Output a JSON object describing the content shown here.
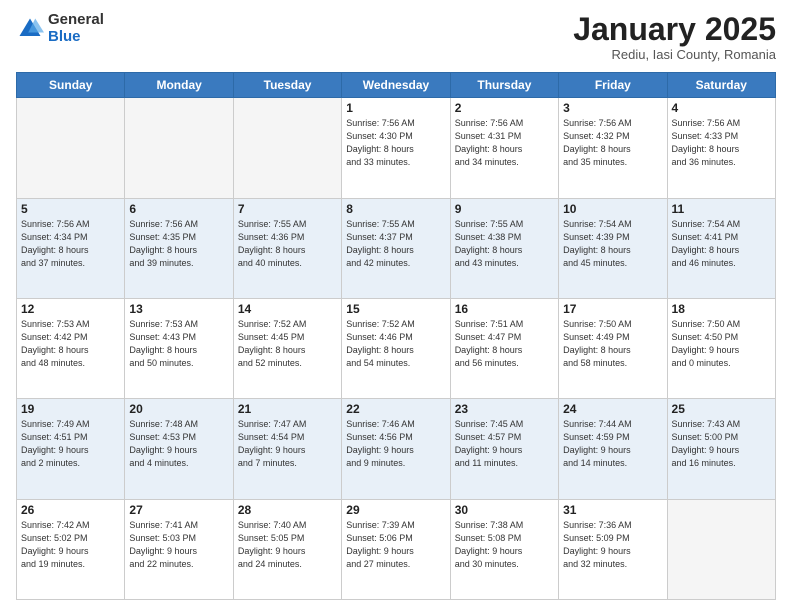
{
  "logo": {
    "general": "General",
    "blue": "Blue"
  },
  "title": "January 2025",
  "subtitle": "Rediu, Iasi County, Romania",
  "weekdays": [
    "Sunday",
    "Monday",
    "Tuesday",
    "Wednesday",
    "Thursday",
    "Friday",
    "Saturday"
  ],
  "weeks": [
    [
      {
        "day": "",
        "info": ""
      },
      {
        "day": "",
        "info": ""
      },
      {
        "day": "",
        "info": ""
      },
      {
        "day": "1",
        "info": "Sunrise: 7:56 AM\nSunset: 4:30 PM\nDaylight: 8 hours\nand 33 minutes."
      },
      {
        "day": "2",
        "info": "Sunrise: 7:56 AM\nSunset: 4:31 PM\nDaylight: 8 hours\nand 34 minutes."
      },
      {
        "day": "3",
        "info": "Sunrise: 7:56 AM\nSunset: 4:32 PM\nDaylight: 8 hours\nand 35 minutes."
      },
      {
        "day": "4",
        "info": "Sunrise: 7:56 AM\nSunset: 4:33 PM\nDaylight: 8 hours\nand 36 minutes."
      }
    ],
    [
      {
        "day": "5",
        "info": "Sunrise: 7:56 AM\nSunset: 4:34 PM\nDaylight: 8 hours\nand 37 minutes."
      },
      {
        "day": "6",
        "info": "Sunrise: 7:56 AM\nSunset: 4:35 PM\nDaylight: 8 hours\nand 39 minutes."
      },
      {
        "day": "7",
        "info": "Sunrise: 7:55 AM\nSunset: 4:36 PM\nDaylight: 8 hours\nand 40 minutes."
      },
      {
        "day": "8",
        "info": "Sunrise: 7:55 AM\nSunset: 4:37 PM\nDaylight: 8 hours\nand 42 minutes."
      },
      {
        "day": "9",
        "info": "Sunrise: 7:55 AM\nSunset: 4:38 PM\nDaylight: 8 hours\nand 43 minutes."
      },
      {
        "day": "10",
        "info": "Sunrise: 7:54 AM\nSunset: 4:39 PM\nDaylight: 8 hours\nand 45 minutes."
      },
      {
        "day": "11",
        "info": "Sunrise: 7:54 AM\nSunset: 4:41 PM\nDaylight: 8 hours\nand 46 minutes."
      }
    ],
    [
      {
        "day": "12",
        "info": "Sunrise: 7:53 AM\nSunset: 4:42 PM\nDaylight: 8 hours\nand 48 minutes."
      },
      {
        "day": "13",
        "info": "Sunrise: 7:53 AM\nSunset: 4:43 PM\nDaylight: 8 hours\nand 50 minutes."
      },
      {
        "day": "14",
        "info": "Sunrise: 7:52 AM\nSunset: 4:45 PM\nDaylight: 8 hours\nand 52 minutes."
      },
      {
        "day": "15",
        "info": "Sunrise: 7:52 AM\nSunset: 4:46 PM\nDaylight: 8 hours\nand 54 minutes."
      },
      {
        "day": "16",
        "info": "Sunrise: 7:51 AM\nSunset: 4:47 PM\nDaylight: 8 hours\nand 56 minutes."
      },
      {
        "day": "17",
        "info": "Sunrise: 7:50 AM\nSunset: 4:49 PM\nDaylight: 8 hours\nand 58 minutes."
      },
      {
        "day": "18",
        "info": "Sunrise: 7:50 AM\nSunset: 4:50 PM\nDaylight: 9 hours\nand 0 minutes."
      }
    ],
    [
      {
        "day": "19",
        "info": "Sunrise: 7:49 AM\nSunset: 4:51 PM\nDaylight: 9 hours\nand 2 minutes."
      },
      {
        "day": "20",
        "info": "Sunrise: 7:48 AM\nSunset: 4:53 PM\nDaylight: 9 hours\nand 4 minutes."
      },
      {
        "day": "21",
        "info": "Sunrise: 7:47 AM\nSunset: 4:54 PM\nDaylight: 9 hours\nand 7 minutes."
      },
      {
        "day": "22",
        "info": "Sunrise: 7:46 AM\nSunset: 4:56 PM\nDaylight: 9 hours\nand 9 minutes."
      },
      {
        "day": "23",
        "info": "Sunrise: 7:45 AM\nSunset: 4:57 PM\nDaylight: 9 hours\nand 11 minutes."
      },
      {
        "day": "24",
        "info": "Sunrise: 7:44 AM\nSunset: 4:59 PM\nDaylight: 9 hours\nand 14 minutes."
      },
      {
        "day": "25",
        "info": "Sunrise: 7:43 AM\nSunset: 5:00 PM\nDaylight: 9 hours\nand 16 minutes."
      }
    ],
    [
      {
        "day": "26",
        "info": "Sunrise: 7:42 AM\nSunset: 5:02 PM\nDaylight: 9 hours\nand 19 minutes."
      },
      {
        "day": "27",
        "info": "Sunrise: 7:41 AM\nSunset: 5:03 PM\nDaylight: 9 hours\nand 22 minutes."
      },
      {
        "day": "28",
        "info": "Sunrise: 7:40 AM\nSunset: 5:05 PM\nDaylight: 9 hours\nand 24 minutes."
      },
      {
        "day": "29",
        "info": "Sunrise: 7:39 AM\nSunset: 5:06 PM\nDaylight: 9 hours\nand 27 minutes."
      },
      {
        "day": "30",
        "info": "Sunrise: 7:38 AM\nSunset: 5:08 PM\nDaylight: 9 hours\nand 30 minutes."
      },
      {
        "day": "31",
        "info": "Sunrise: 7:36 AM\nSunset: 5:09 PM\nDaylight: 9 hours\nand 32 minutes."
      },
      {
        "day": "",
        "info": ""
      }
    ]
  ]
}
